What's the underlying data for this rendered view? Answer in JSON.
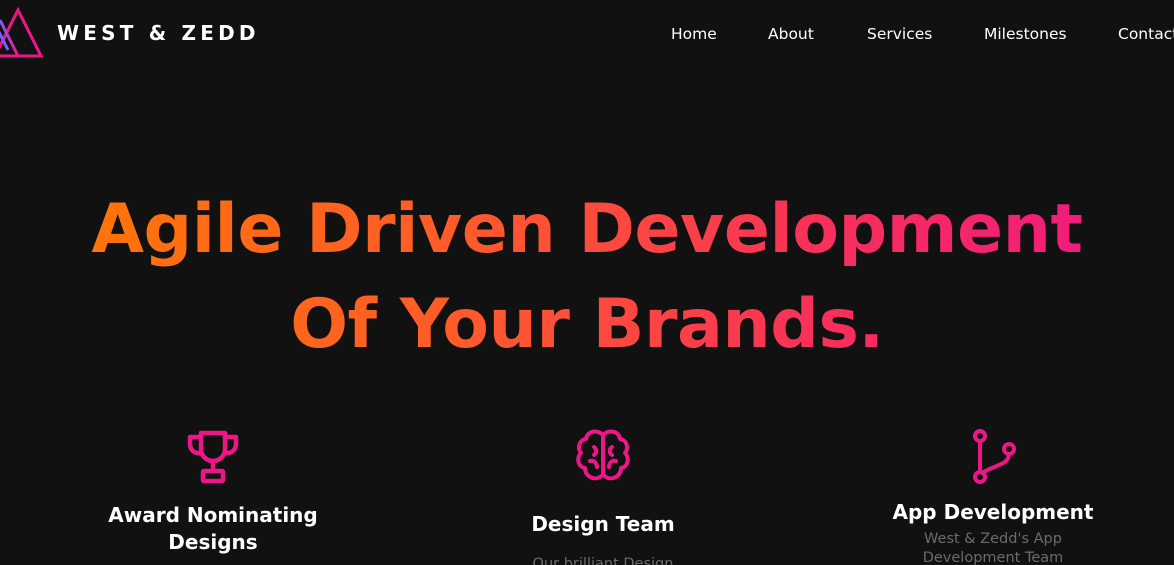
{
  "header": {
    "brand": "WEST & ZEDD",
    "logo_icon": "triangle-mountain-logo-icon",
    "nav": [
      "Home",
      "About",
      "Services",
      "Milestones",
      "Contact"
    ]
  },
  "hero": {
    "line1": "Agile Driven Development",
    "line2": "Of Your Brands.",
    "gradient_start": "#ff7a00",
    "gradient_end": "#ee1687"
  },
  "features": [
    {
      "icon": "trophy-icon",
      "title_line1": "Award Nominating",
      "title_line2": "Designs",
      "desc": ""
    },
    {
      "icon": "brain-icon",
      "title_line1": "Design Team",
      "title_line2": "",
      "desc": "Our brilliant Design"
    },
    {
      "icon": "git-branch-icon",
      "title_line1": "App Development",
      "title_line2": "",
      "desc_line1": "West & Zedd's App",
      "desc_line2": "Development Team"
    }
  ],
  "colors": {
    "background": "#111111",
    "accent": "#ee1687",
    "text": "#ffffff",
    "muted": "#6b6b6b"
  }
}
